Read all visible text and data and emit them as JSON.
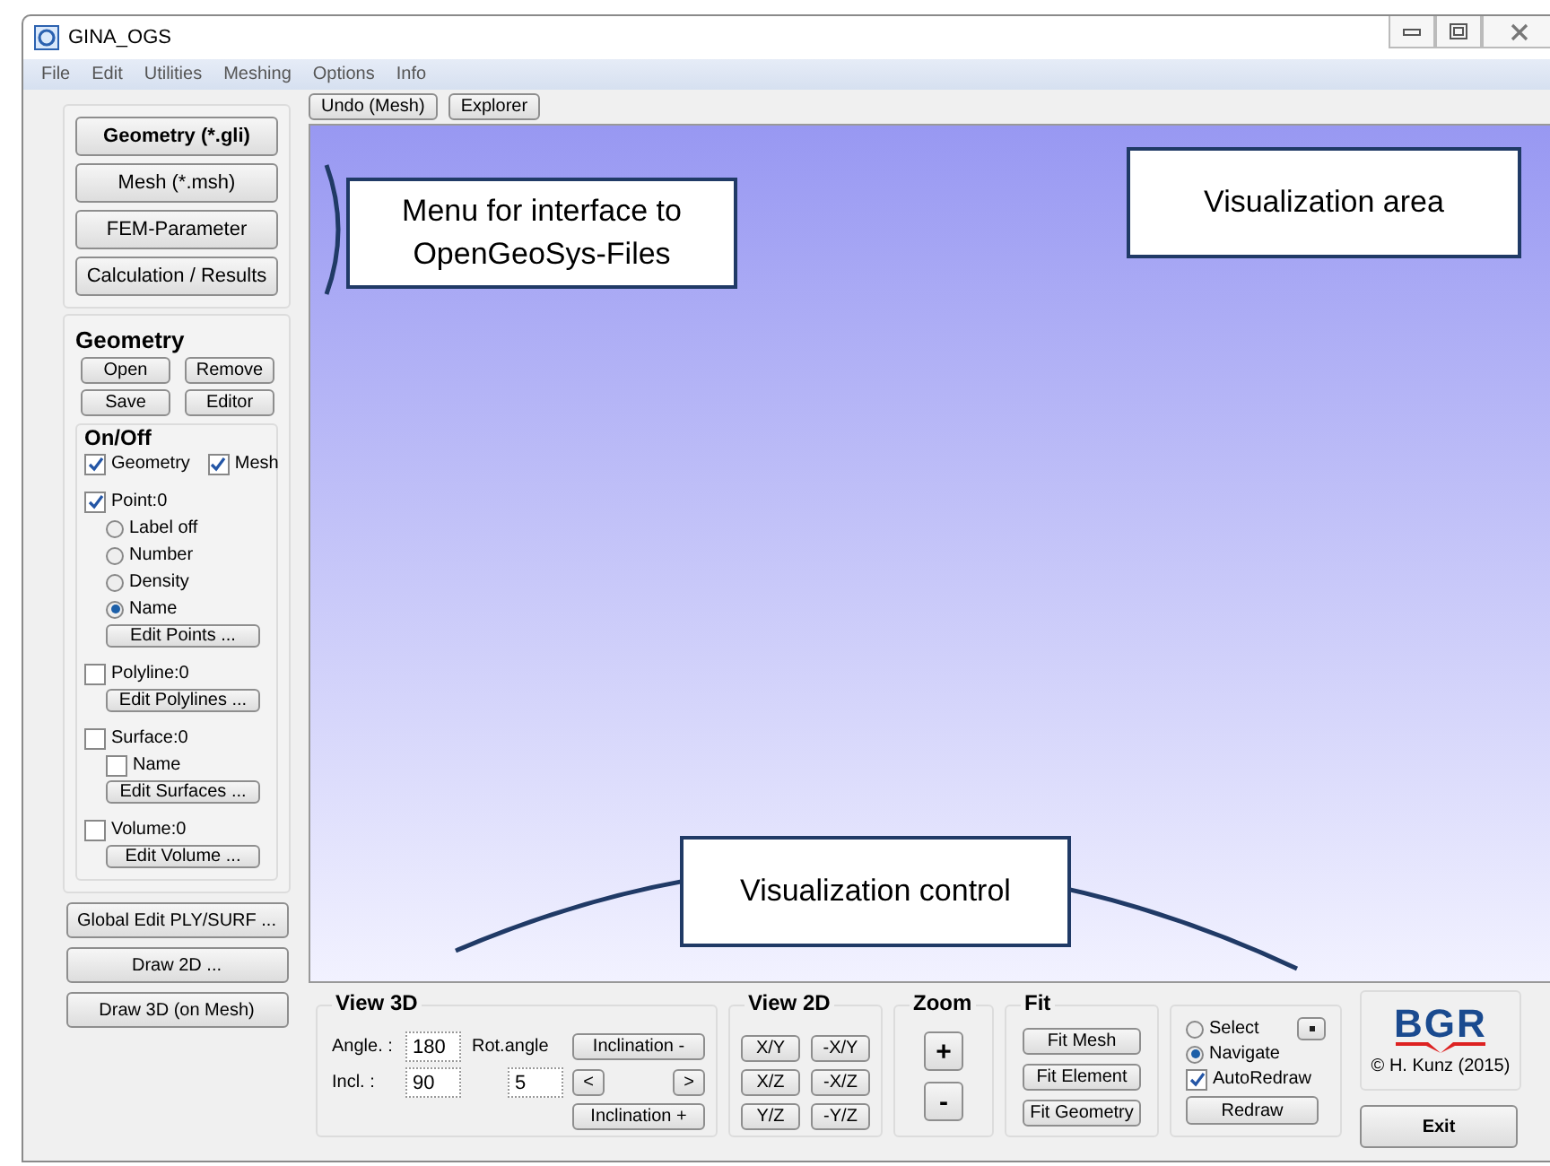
{
  "window": {
    "title": "GINA_OGS"
  },
  "menu": [
    "File",
    "Edit",
    "Utilities",
    "Meshing",
    "Options",
    "Info"
  ],
  "toolbar": [
    "Undo (Mesh)",
    "Explorer"
  ],
  "nav_buttons": [
    {
      "label": "Geometry (*.gli)",
      "selected": true
    },
    {
      "label": "Mesh (*.msh)",
      "selected": false
    },
    {
      "label": "FEM-Parameter",
      "selected": false
    },
    {
      "label": "Calculation / Results",
      "selected": false
    }
  ],
  "geometry_panel": {
    "title": "Geometry",
    "buttons": [
      "Open",
      "Remove",
      "Save",
      "Editor"
    ]
  },
  "on_off": {
    "title": "On/Off",
    "toggles": [
      {
        "label": "Geometry",
        "checked": true
      },
      {
        "label": "Mesh",
        "checked": true
      }
    ],
    "layers": [
      {
        "label": "Point:0",
        "checked": true,
        "children": [
          {
            "kind": "radio",
            "label": "Label off",
            "selected": false
          },
          {
            "kind": "radio",
            "label": "Number",
            "selected": false
          },
          {
            "kind": "radio",
            "label": "Density",
            "selected": false
          },
          {
            "kind": "radio",
            "label": "Name",
            "selected": true
          },
          {
            "kind": "button",
            "label": "Edit Points ..."
          }
        ]
      },
      {
        "label": "Polyline:0",
        "checked": false,
        "children": [
          {
            "kind": "button",
            "label": "Edit Polylines ..."
          }
        ]
      },
      {
        "label": "Surface:0",
        "checked": false,
        "children": [
          {
            "kind": "checkbox",
            "label": "Name",
            "checked": false
          },
          {
            "kind": "button",
            "label": "Edit Surfaces ..."
          }
        ]
      },
      {
        "label": "Volume:0",
        "checked": false,
        "children": [
          {
            "kind": "button",
            "label": "Edit Volume ..."
          }
        ]
      }
    ]
  },
  "side_buttons": [
    "Global Edit PLY/SURF ...",
    "Draw 2D ...",
    "Draw 3D (on Mesh)"
  ],
  "annotations": [
    {
      "text": "Menu for interface to OpenGeoSys-Files"
    },
    {
      "text": "Visualization area"
    },
    {
      "text": "Visualization control"
    }
  ],
  "view_3d": {
    "title": "View 3D",
    "angle_label": "Angle. :",
    "angle": "180",
    "incl_label": "Incl. :",
    "incl": "90",
    "rot_label": "Rot.angle",
    "rot": "5",
    "inclination_minus": "Inclination -",
    "left": "<",
    "right": ">",
    "inclination_plus": "Inclination +"
  },
  "view_2d": {
    "title": "View 2D",
    "buttons": [
      "X/Y",
      "-X/Y",
      "X/Z",
      "-X/Z",
      "Y/Z",
      "-Y/Z"
    ]
  },
  "zoom": {
    "title": "Zoom",
    "buttons": [
      "+",
      "-"
    ]
  },
  "fit": {
    "title": "Fit",
    "buttons": [
      "Fit Mesh",
      "Fit Element",
      "Fit Geometry"
    ]
  },
  "mode": {
    "options": [
      {
        "label": "Select",
        "selected": false
      },
      {
        "label": "Navigate",
        "selected": true
      }
    ],
    "auto_redraw": {
      "label": "AutoRedraw",
      "checked": true
    },
    "redraw": "Redraw"
  },
  "logo": {
    "text": "BGR",
    "credit": "© H. Kunz (2015)"
  },
  "exit": "Exit"
}
